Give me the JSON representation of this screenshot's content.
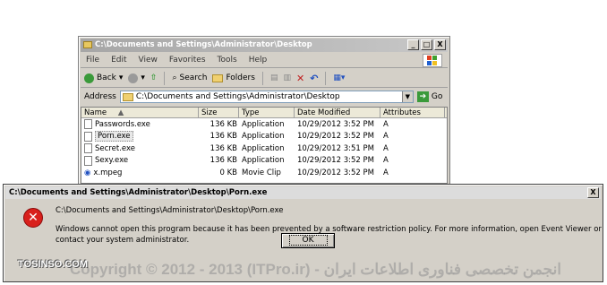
{
  "explorer": {
    "title": "C:\\Documents and Settings\\Administrator\\Desktop",
    "window_buttons": [
      "_",
      "□",
      "X"
    ],
    "menu": [
      "File",
      "Edit",
      "View",
      "Favorites",
      "Tools",
      "Help"
    ],
    "toolbar": {
      "back": "Back",
      "search": "Search",
      "folders": "Folders"
    },
    "address_label": "Address",
    "address_value": "C:\\Documents and Settings\\Administrator\\Desktop",
    "go_label": "Go",
    "columns": [
      "Name",
      "Size",
      "Type",
      "Date Modified",
      "Attributes"
    ],
    "files": [
      {
        "name": "Passwords.exe",
        "size": "136 KB",
        "type": "Application",
        "date": "10/29/2012 3:52 PM",
        "attr": "A"
      },
      {
        "name": "Porn.exe",
        "size": "136 KB",
        "type": "Application",
        "date": "10/29/2012 3:52 PM",
        "attr": "A"
      },
      {
        "name": "Secret.exe",
        "size": "136 KB",
        "type": "Application",
        "date": "10/29/2012 3:51 PM",
        "attr": "A"
      },
      {
        "name": "Sexy.exe",
        "size": "136 KB",
        "type": "Application",
        "date": "10/29/2012 3:52 PM",
        "attr": "A"
      },
      {
        "name": "x.mpeg",
        "size": "0 KB",
        "type": "Movie Clip",
        "date": "10/29/2012 3:52 PM",
        "attr": "A"
      }
    ]
  },
  "dialog": {
    "title": "C:\\Documents and Settings\\Administrator\\Desktop\\Porn.exe",
    "close": "X",
    "path": "C:\\Documents and Settings\\Administrator\\Desktop\\Porn.exe",
    "message": "Windows cannot open this program because it has been prevented by a software restriction policy. For more information, open Event Viewer or contact your system administrator.",
    "ok": "OK"
  },
  "watermark": {
    "brand": "TOSINSO.COM",
    "copyright": "Copyright © 2012 - 2013 (ITPro.ir) - انجمن تخصصی فناوری اطلاعات ایران"
  }
}
